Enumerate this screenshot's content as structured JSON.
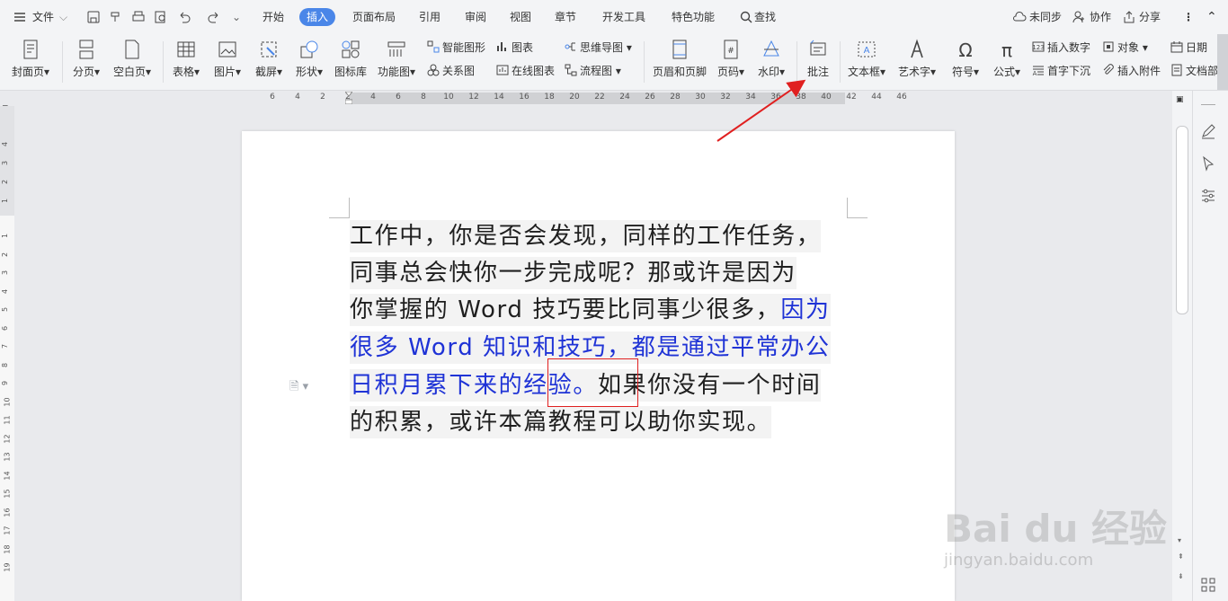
{
  "menubar": {
    "file": "文件",
    "tabs": [
      "开始",
      "插入",
      "页面布局",
      "引用",
      "审阅",
      "视图",
      "章节",
      "开发工具",
      "特色功能"
    ],
    "active_tab": "插入",
    "search": "查找",
    "sync": "未同步",
    "collab": "协作",
    "share": "分享"
  },
  "ribbon": {
    "cover": "封面页",
    "pagebreak": "分页",
    "blank": "空白页",
    "table": "表格",
    "picture": "图片",
    "screenshot": "截屏",
    "shape": "形状",
    "iconlib": "图标库",
    "funcchart": "功能图",
    "smartart": "智能图形",
    "chart": "图表",
    "mindmap": "思维导图",
    "relation": "关系图",
    "onlinechart": "在线图表",
    "flowchart": "流程图",
    "headerfooter": "页眉和页脚",
    "pagenum": "页码",
    "watermark": "水印",
    "comment": "批注",
    "textbox": "文本框",
    "wordart": "艺术字",
    "symbol": "符号",
    "formula": "公式",
    "insertnum": "插入数字",
    "object": "对象",
    "dropcap": "首字下沉",
    "attach": "插入附件",
    "date": "日期",
    "docparts": "文档部"
  },
  "ruler_numbers": [
    "6",
    "4",
    "2",
    "2",
    "4",
    "6",
    "8",
    "10",
    "12",
    "14",
    "16",
    "18",
    "20",
    "22",
    "24",
    "26",
    "28",
    "30",
    "32",
    "34",
    "36",
    "38",
    "40",
    "42",
    "44",
    "46"
  ],
  "vruler_numbers": [
    "4",
    "3",
    "2",
    "1",
    "1",
    "2",
    "3",
    "4",
    "5",
    "6",
    "7",
    "8",
    "9",
    "10",
    "11",
    "12",
    "13",
    "14",
    "15",
    "16",
    "17",
    "18",
    "19"
  ],
  "document": {
    "lines": [
      [
        {
          "t": "工作中，你是否会发现，同样的工作任务，",
          "c": "normal"
        }
      ],
      [
        {
          "t": "同事总会快你一步完成呢？那或许是因为",
          "c": "normal"
        }
      ],
      [
        {
          "t": "你掌握的 Word 技巧要比同事少很多，",
          "c": "normal"
        },
        {
          "t": "因为",
          "c": "blue"
        }
      ],
      [
        {
          "t": "很多 Word 知识和技巧，都是通过平常办公",
          "c": "blue"
        }
      ],
      [
        {
          "t": "日积月累下来的经验。",
          "c": "blue"
        },
        {
          "t": "如果你没有一个时间",
          "c": "normal"
        }
      ],
      [
        {
          "t": "的积累，或许本篇教程可以助你实现。",
          "c": "normal"
        }
      ]
    ]
  },
  "watermark": {
    "brand": "Bai du 经验",
    "url": "jingyan.baidu.com"
  },
  "colors": {
    "accent": "#4a86e8",
    "highlight_text": "#1f33d6",
    "callout": "#e02020"
  }
}
